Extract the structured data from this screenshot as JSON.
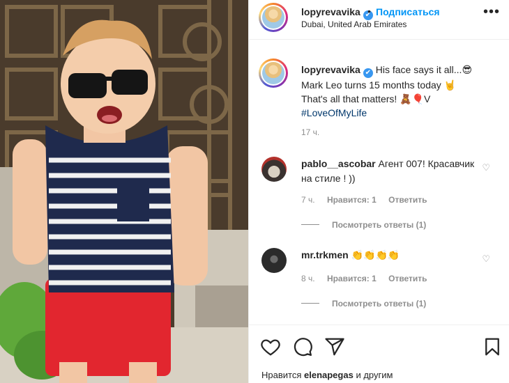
{
  "post": {
    "author": "lopyrevavika",
    "verified_mark": "✔",
    "dot": "•",
    "follow_label": "Подписаться",
    "location": "Dubai, United Arab Emirates",
    "more_icon": "more-horizontal-icon",
    "more_glyph": "•••"
  },
  "caption": {
    "author": "lopyrevavika",
    "text_line1": "His face says it all...😎",
    "text_line2": "Mark Leo turns 15 months today 🤘",
    "text_line3": "That's all that matters! 🧸🎈V",
    "hashtag": "#LoveOfMyLife",
    "time": "17 ч."
  },
  "comments": [
    {
      "username": "pablo__ascobar",
      "text": "Агент 007! Красавчик на стиле ! ))",
      "time": "7 ч.",
      "likes": "Нравится: 1",
      "reply": "Ответить",
      "view_replies": "Посмотреть ответы (1)"
    },
    {
      "username": "mr.trkmen",
      "text": "👏👏👏👏",
      "time": "8 ч.",
      "likes": "Нравится: 1",
      "reply": "Ответить",
      "view_replies": "Посмотреть ответы (1)"
    }
  ],
  "footer": {
    "likes_prefix": "Нравится",
    "likes_user": "elenapegas",
    "likes_suffix": "и другим"
  },
  "icons": {
    "heart": "heart-icon",
    "comment": "comment-icon",
    "share": "share-icon",
    "save": "bookmark-icon"
  },
  "colors": {
    "link_blue": "#0095f6",
    "hashtag": "#00376b",
    "verified": "#3897f0",
    "muted": "#8e8e8e"
  }
}
